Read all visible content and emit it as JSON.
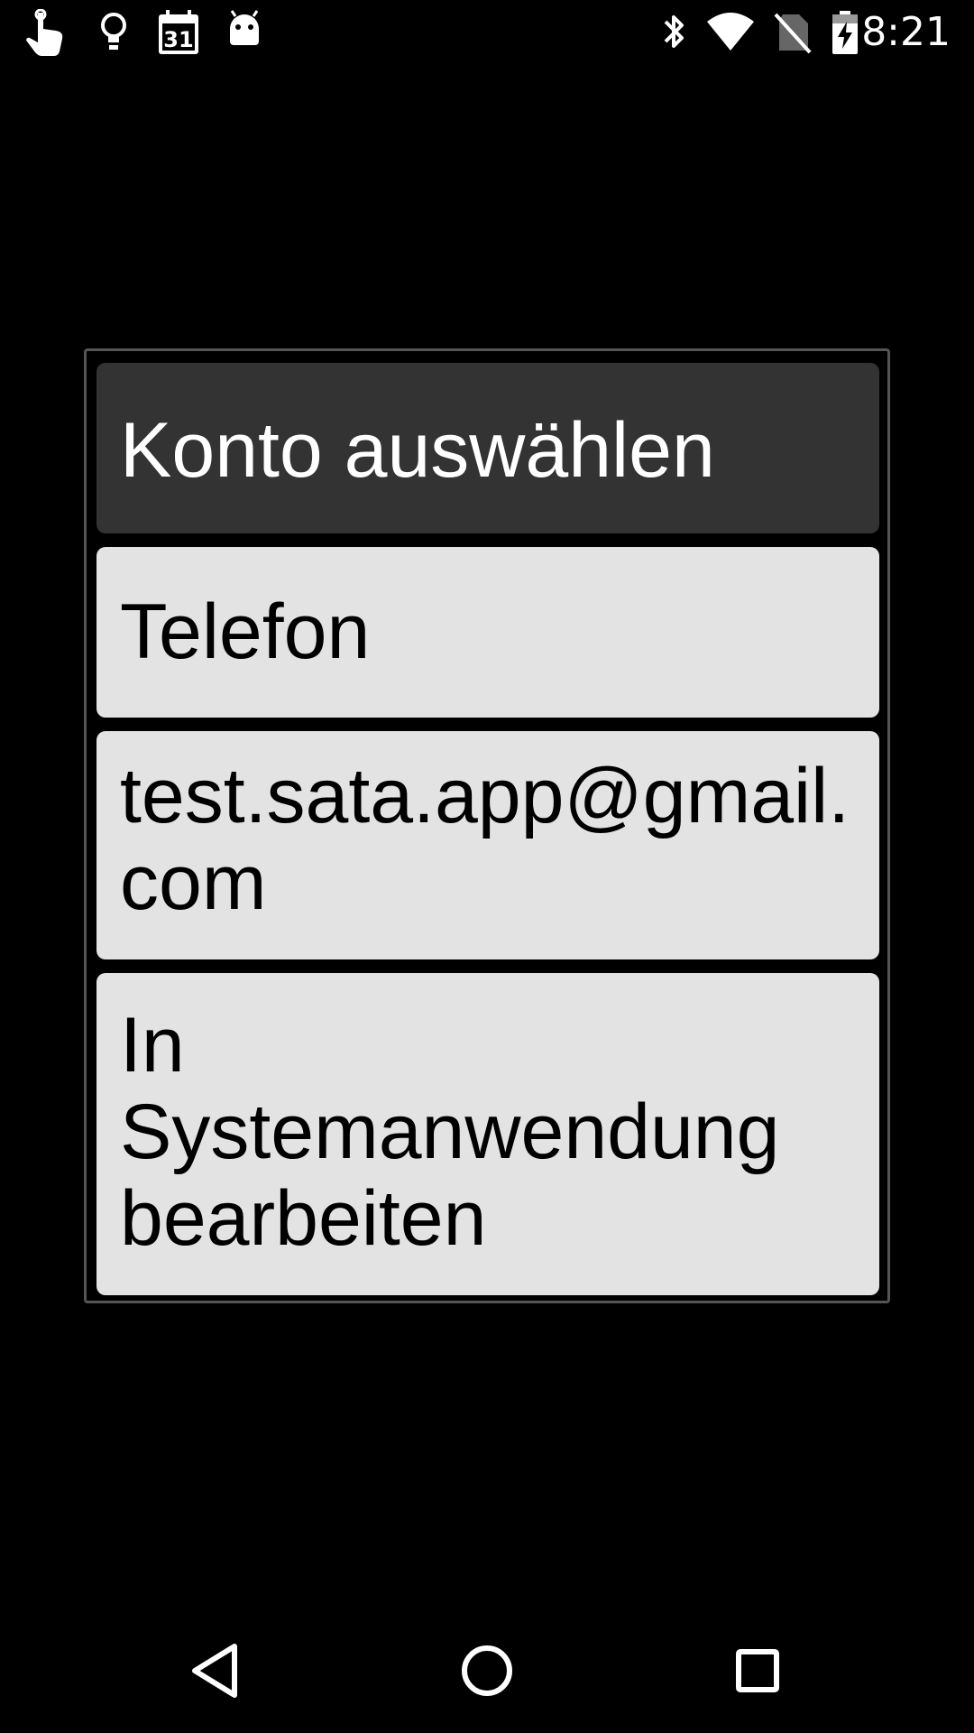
{
  "status_bar": {
    "left_icons": [
      "touch-hand-icon",
      "lightbulb-icon",
      "calendar-icon",
      "android-icon"
    ],
    "calendar_day": "31",
    "right_icons": [
      "bluetooth-icon",
      "wifi-icon",
      "no-sim-icon",
      "battery-charging-icon"
    ],
    "time": "8:21"
  },
  "dialog": {
    "title": "Konto auswählen",
    "options": [
      {
        "label": "Telefon"
      },
      {
        "label": "test.sata.app@gmail.com"
      },
      {
        "label": "In Systemanwendung bearbeiten"
      }
    ]
  },
  "nav_bar": {
    "buttons": [
      "back-icon",
      "home-icon",
      "recent-apps-icon"
    ]
  },
  "colors": {
    "background": "#000000",
    "title_box": "#333333",
    "option_box": "#e3e3e3",
    "dialog_border": "#555555"
  }
}
